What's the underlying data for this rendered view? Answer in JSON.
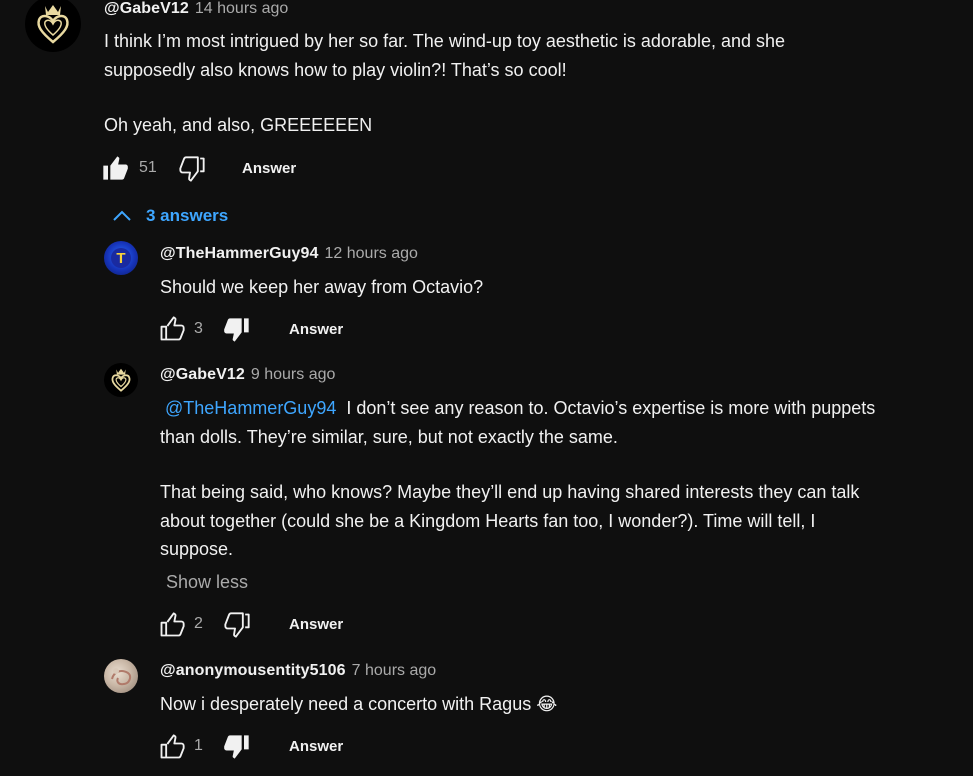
{
  "top_comment": {
    "handle": "@GabeV12",
    "time": "14 hours ago",
    "line1": "I think I’m most intrigued by her so far. The wind-up toy aesthetic is adorable, and she",
    "line2": "supposedly also knows how to play violin?! That’s so cool!",
    "line3": "Oh yeah, and also, GREEEEEEN",
    "likes": "51",
    "answer_label": "Answer",
    "avatar_icon": "kingdom-hearts-crown-heart-icon"
  },
  "replies_toggle": {
    "label": "3 answers",
    "icon": "chevron-up-icon"
  },
  "replies": [
    {
      "handle": "@TheHammerGuy94",
      "time": "12 hours ago",
      "text": "Should we keep her away from Octavio?",
      "likes": "3",
      "answer_label": "Answer",
      "avatar_letter": "T"
    },
    {
      "handle": "@GabeV12",
      "time": "9 hours ago",
      "mention": "@TheHammerGuy94",
      "line1": "I don’t see any reason to. Octavio’s expertise is more with puppets",
      "line2": "than dolls. They’re similar, sure, but not exactly the same.",
      "line3": "That being said, who knows? Maybe they’ll end up having shared interests they can talk",
      "line4": "about together (could she be a Kingdom Hearts fan too, I wonder?). Time will tell, I",
      "line5": "suppose.",
      "show_less": "Show less",
      "likes": "2",
      "answer_label": "Answer"
    },
    {
      "handle": "@anonymousentity5106",
      "time": "7 hours ago",
      "text": "Now i desperately need a concerto with Ragus",
      "emoji": "😂",
      "likes": "1",
      "answer_label": "Answer"
    }
  ],
  "colors": {
    "background": "#0f0f0f",
    "text": "#f1f1f1",
    "secondary": "#aaaaaa",
    "link": "#3ea6ff"
  }
}
